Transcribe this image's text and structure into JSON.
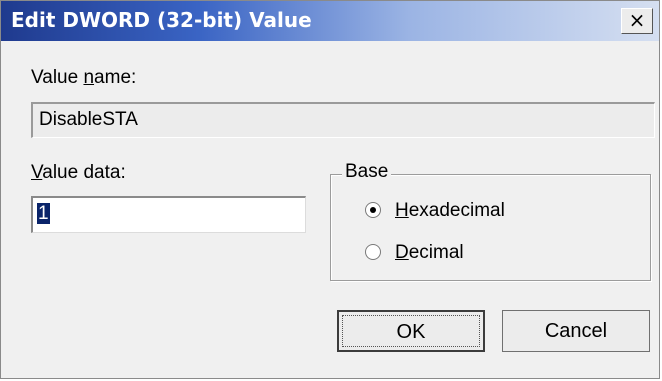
{
  "window": {
    "title": "Edit DWORD (32-bit) Value",
    "close_glyph": "×"
  },
  "value_name": {
    "label_prefix": "Value ",
    "label_access_key": "n",
    "label_suffix": "ame:",
    "value": "DisableSTA"
  },
  "value_data": {
    "label_access_key": "V",
    "label_suffix": "alue data:",
    "value": "1"
  },
  "base": {
    "legend": "Base",
    "options": [
      {
        "access_key": "H",
        "rest": "exadecimal",
        "selected": true
      },
      {
        "access_key": "D",
        "rest": "ecimal",
        "selected": false
      }
    ]
  },
  "buttons": {
    "ok": "OK",
    "cancel": "Cancel"
  },
  "colors": {
    "title_gradient_start": "#1f3a8e",
    "title_gradient_end": "#d5dff1",
    "dialog_background": "#f0f0f0",
    "selection": "#0a246a"
  },
  "icons": {
    "close": "close-icon",
    "radio_selected": "radio-selected-icon",
    "radio_unselected": "radio-unselected-icon"
  }
}
